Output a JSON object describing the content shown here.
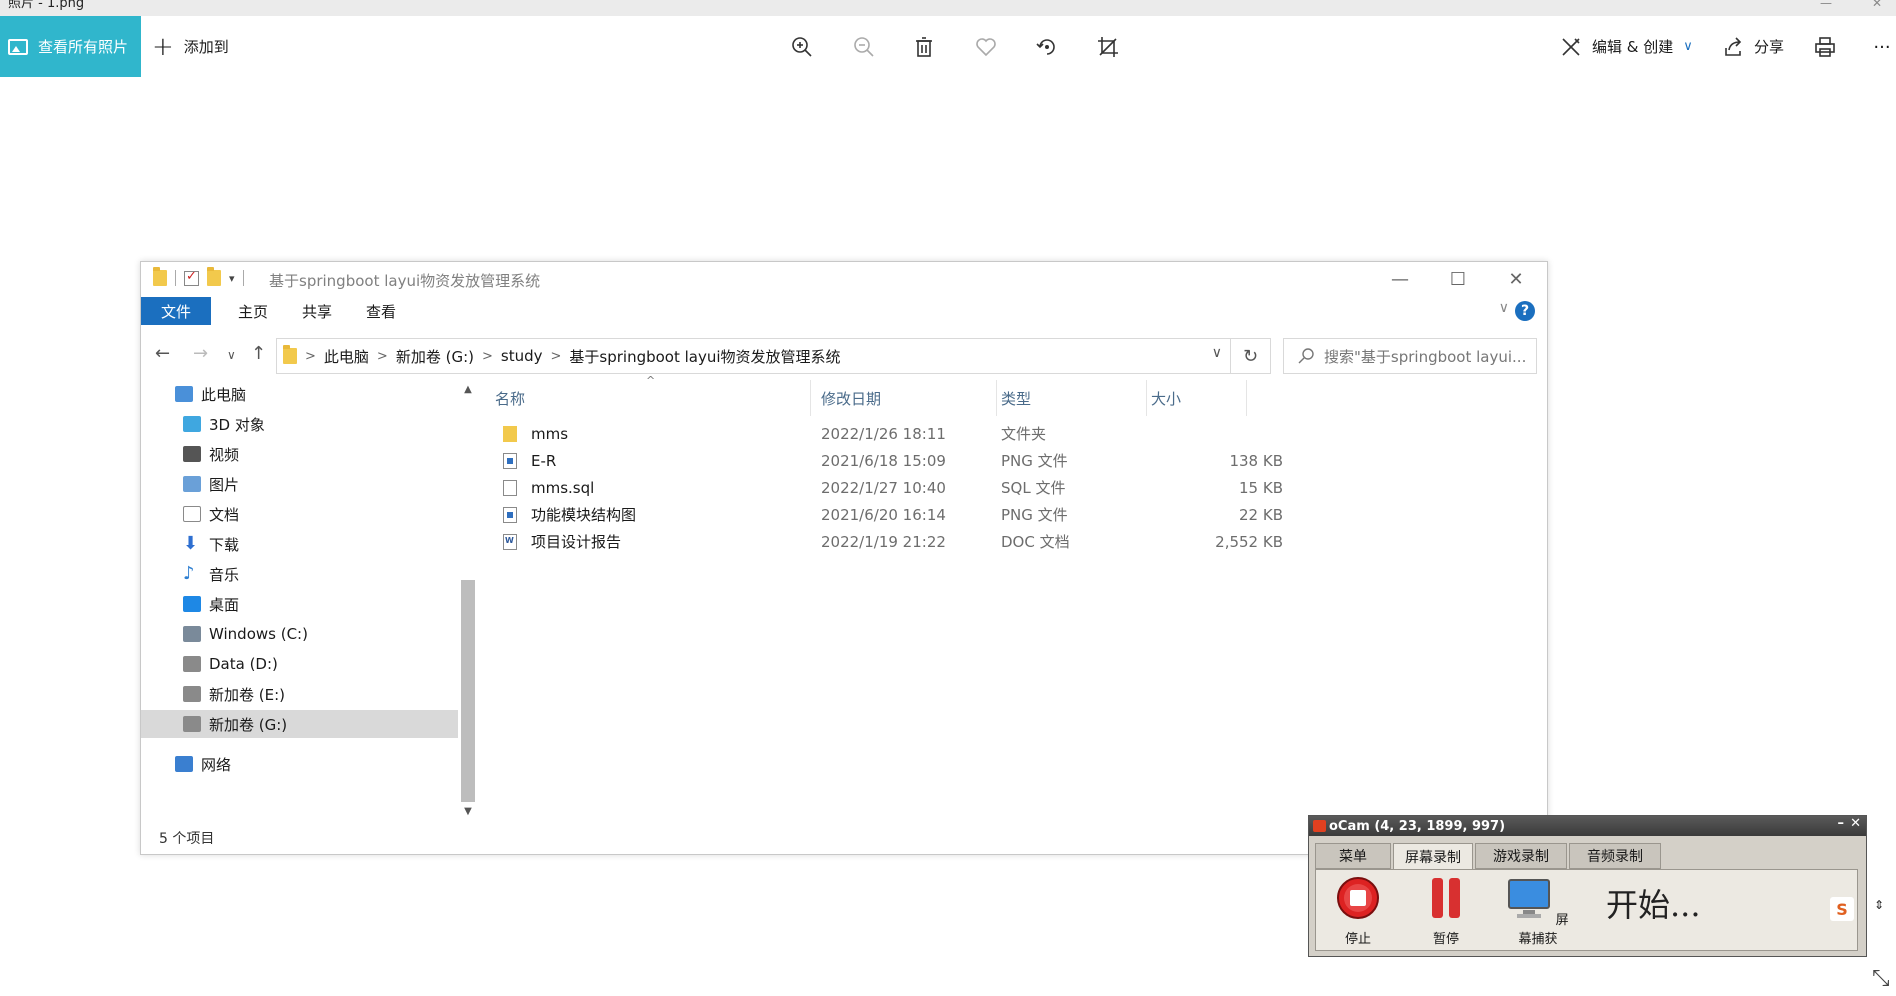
{
  "photos": {
    "window_title": "照片 - 1.png",
    "view_all_label": "查看所有照片",
    "add_to_label": "添加到",
    "edit_create_label": "编辑 & 创建",
    "share_label": "分享",
    "more_label": "···"
  },
  "explorer": {
    "title": "基于springboot layui物资发放管理系统",
    "ribbon_tabs": [
      "文件",
      "主页",
      "共享",
      "查看"
    ],
    "help_label": "?",
    "breadcrumb": [
      "此电脑",
      "新加卷 (G:)",
      "study",
      "基于springboot layui物资发放管理系统"
    ],
    "search_placeholder": "搜索\"基于springboot layui...",
    "nav_items": [
      {
        "label": "此电脑",
        "icon": "computer-icon",
        "color": "#4a90d9"
      },
      {
        "label": "3D 对象",
        "icon": "cube-3d-icon",
        "color": "#3fa7e0"
      },
      {
        "label": "视频",
        "icon": "video-icon",
        "color": "#555555"
      },
      {
        "label": "图片",
        "icon": "pictures-icon",
        "color": "#6aa0d8"
      },
      {
        "label": "文档",
        "icon": "documents-icon",
        "color": "#8a8a8a"
      },
      {
        "label": "下载",
        "icon": "download-icon",
        "color": "#2e6fd1"
      },
      {
        "label": "音乐",
        "icon": "music-icon",
        "color": "#2e7fd1"
      },
      {
        "label": "桌面",
        "icon": "desktop-icon",
        "color": "#1e88e5"
      },
      {
        "label": "Windows (C:)",
        "icon": "drive-c-icon",
        "color": "#7a8a9a"
      },
      {
        "label": "Data (D:)",
        "icon": "drive-d-icon",
        "color": "#8a8a8a"
      },
      {
        "label": "新加卷 (E:)",
        "icon": "drive-e-icon",
        "color": "#8a8a8a"
      },
      {
        "label": "新加卷 (G:)",
        "icon": "drive-g-icon",
        "color": "#8a8a8a"
      },
      {
        "label": "网络",
        "icon": "network-icon",
        "color": "#3a7fd0"
      }
    ],
    "selected_nav": "新加卷 (G:)",
    "columns": {
      "name": "名称",
      "date": "修改日期",
      "type": "类型",
      "size": "大小"
    },
    "files": [
      {
        "name": "mms",
        "date": "2022/1/26 18:11",
        "type": "文件夹",
        "size": "",
        "icon": "folder"
      },
      {
        "name": "E-R",
        "date": "2021/6/18 15:09",
        "type": "PNG 文件",
        "size": "138 KB",
        "icon": "png"
      },
      {
        "name": "mms.sql",
        "date": "2022/1/27 10:40",
        "type": "SQL 文件",
        "size": "15 KB",
        "icon": "sql"
      },
      {
        "name": "功能模块结构图",
        "date": "2021/6/20 16:14",
        "type": "PNG 文件",
        "size": "22 KB",
        "icon": "png"
      },
      {
        "name": "项目设计报告",
        "date": "2022/1/19 21:22",
        "type": "DOC 文档",
        "size": "2,552 KB",
        "icon": "doc"
      }
    ],
    "status": "5 个项目"
  },
  "ocam": {
    "title": "oCam (4, 23, 1899, 997)",
    "tabs": [
      "菜单",
      "屏幕录制",
      "游戏录制",
      "音频录制"
    ],
    "active_tab": "屏幕录制",
    "buttons": {
      "stop": "停止",
      "pause": "暂停",
      "capture": "屏幕捕获"
    },
    "status": "开始...",
    "ime_label": "S"
  }
}
